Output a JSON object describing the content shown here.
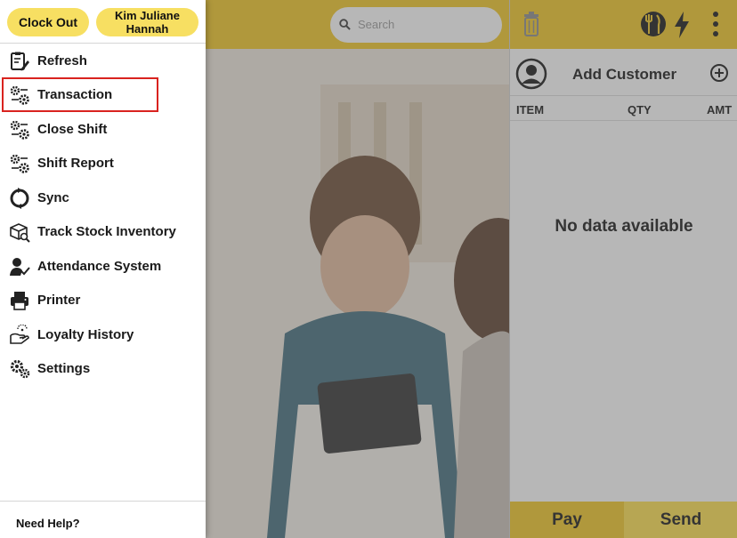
{
  "drawer": {
    "clock_out_label": "Clock Out",
    "user_name_line1": "Kim Juliane",
    "user_name_line2": "Hannah",
    "menu_items": [
      {
        "label": "Refresh",
        "icon": "clipboard-edit-icon"
      },
      {
        "label": "Transaction",
        "icon": "gears-icon",
        "highlighted": true
      },
      {
        "label": "Close Shift",
        "icon": "gears-icon"
      },
      {
        "label": "Shift Report",
        "icon": "gears-icon"
      },
      {
        "label": "Sync",
        "icon": "sync-icon"
      },
      {
        "label": "Track Stock Inventory",
        "icon": "box-search-icon"
      },
      {
        "label": "Attendance System",
        "icon": "user-check-icon"
      },
      {
        "label": "Printer",
        "icon": "printer-icon"
      },
      {
        "label": "Loyalty History",
        "icon": "loyalty-icon"
      },
      {
        "label": "Settings",
        "icon": "settings-icon"
      }
    ],
    "help_label": "Need Help?"
  },
  "header": {
    "search_placeholder": "Search"
  },
  "cart": {
    "add_customer_label": "Add Customer",
    "columns": [
      "ITEM",
      "QTY",
      "AMT"
    ],
    "empty_message": "No data available",
    "pay_label": "Pay",
    "send_label": "Send"
  },
  "colors": {
    "accent": "#f3c61f",
    "button": "#f7df62",
    "highlight_border": "#d9231f"
  }
}
